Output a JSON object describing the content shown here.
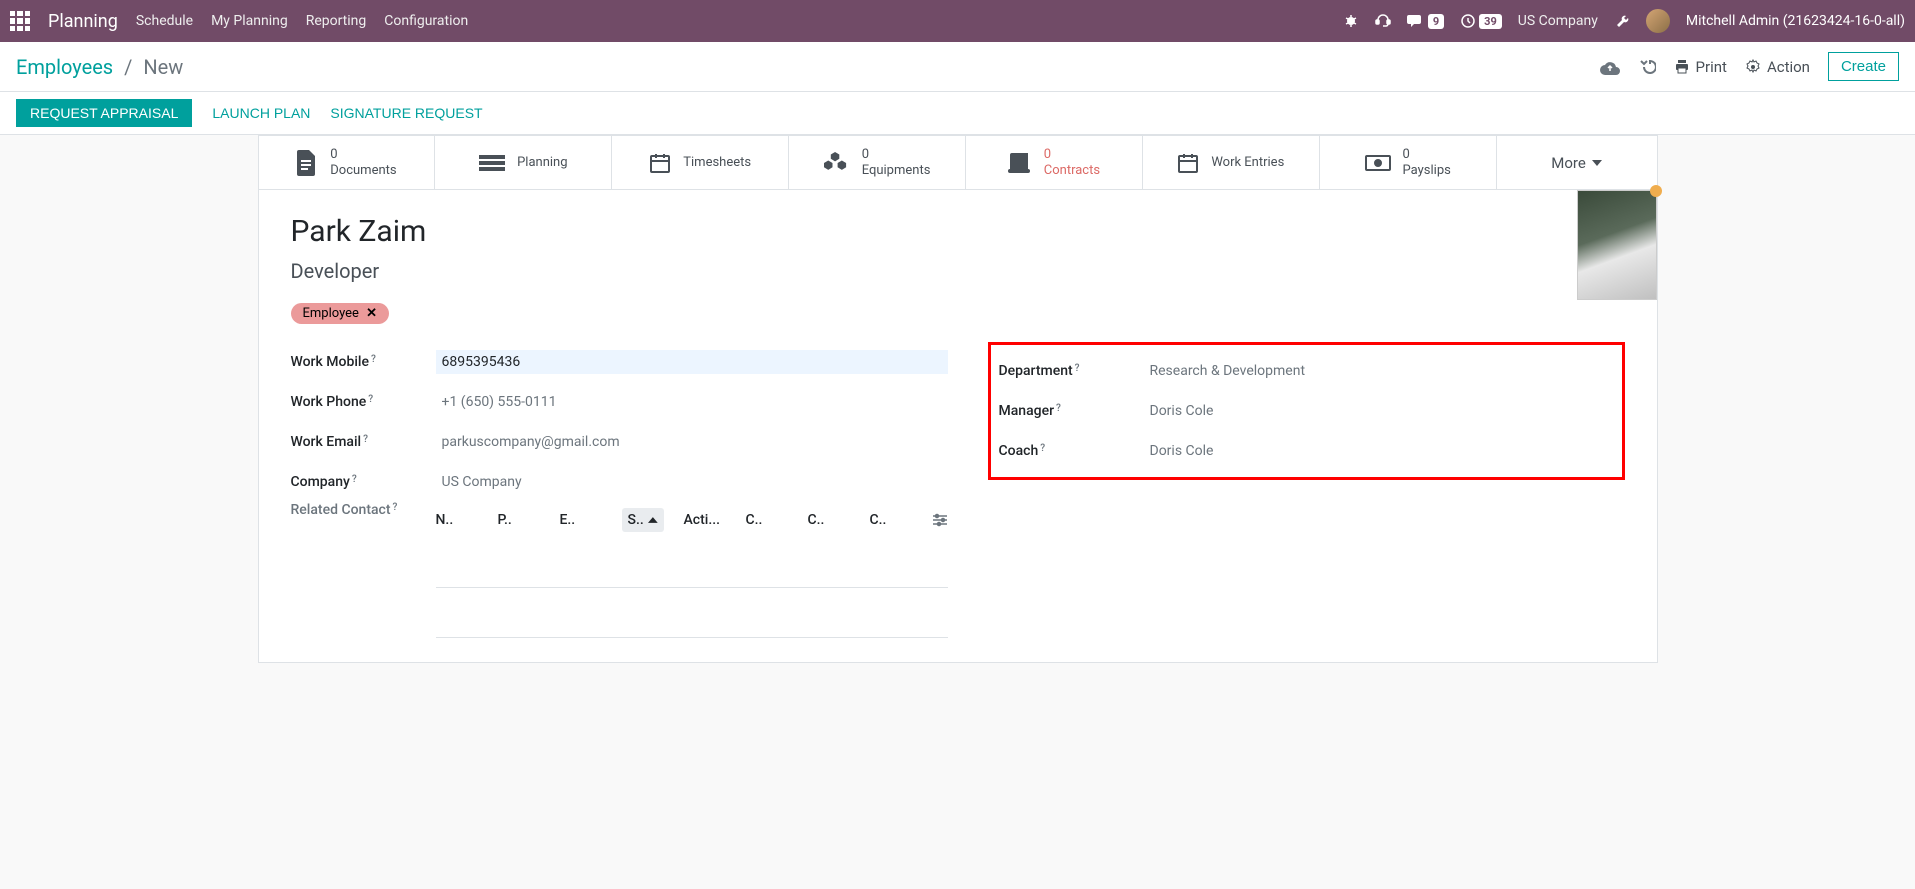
{
  "navbar": {
    "brand": "Planning",
    "links": [
      "Schedule",
      "My Planning",
      "Reporting",
      "Configuration"
    ],
    "msg_count": "9",
    "clock_count": "39",
    "company": "US Company",
    "user": "Mitchell Admin (21623424-16-0-all)"
  },
  "breadcrumb": {
    "parent": "Employees",
    "current": "New"
  },
  "cp": {
    "print": "Print",
    "action": "Action",
    "create": "Create"
  },
  "status": {
    "appraisal": "REQUEST APPRAISAL",
    "launch": "LAUNCH PLAN",
    "signature": "SIGNATURE REQUEST"
  },
  "stats": {
    "documents_count": "0",
    "documents_label": "Documents",
    "planning_label": "Planning",
    "timesheets_label": "Timesheets",
    "equipments_count": "0",
    "equipments_label": "Equipments",
    "contracts_count": "0",
    "contracts_label": "Contracts",
    "work_entries_label": "Work Entries",
    "payslips_count": "0",
    "payslips_label": "Payslips",
    "more": "More"
  },
  "employee": {
    "name": "Park Zaim",
    "title": "Developer",
    "tag": "Employee"
  },
  "fields": {
    "work_mobile_label": "Work Mobile",
    "work_mobile": "6895395436",
    "work_phone_label": "Work Phone",
    "work_phone": "+1 (650) 555-0111",
    "work_email_label": "Work Email",
    "work_email": "parkuscompany@gmail.com",
    "company_label": "Company",
    "company": "US Company",
    "related_contact_label": "Related Contact",
    "department_label": "Department",
    "department": "Research & Development",
    "manager_label": "Manager",
    "manager": "Doris Cole",
    "coach_label": "Coach",
    "coach": "Doris Cole"
  },
  "kanban": {
    "cols": [
      "N..",
      "P..",
      "E..",
      "S..",
      "Acti...",
      "C..",
      "C..",
      "C.."
    ]
  }
}
